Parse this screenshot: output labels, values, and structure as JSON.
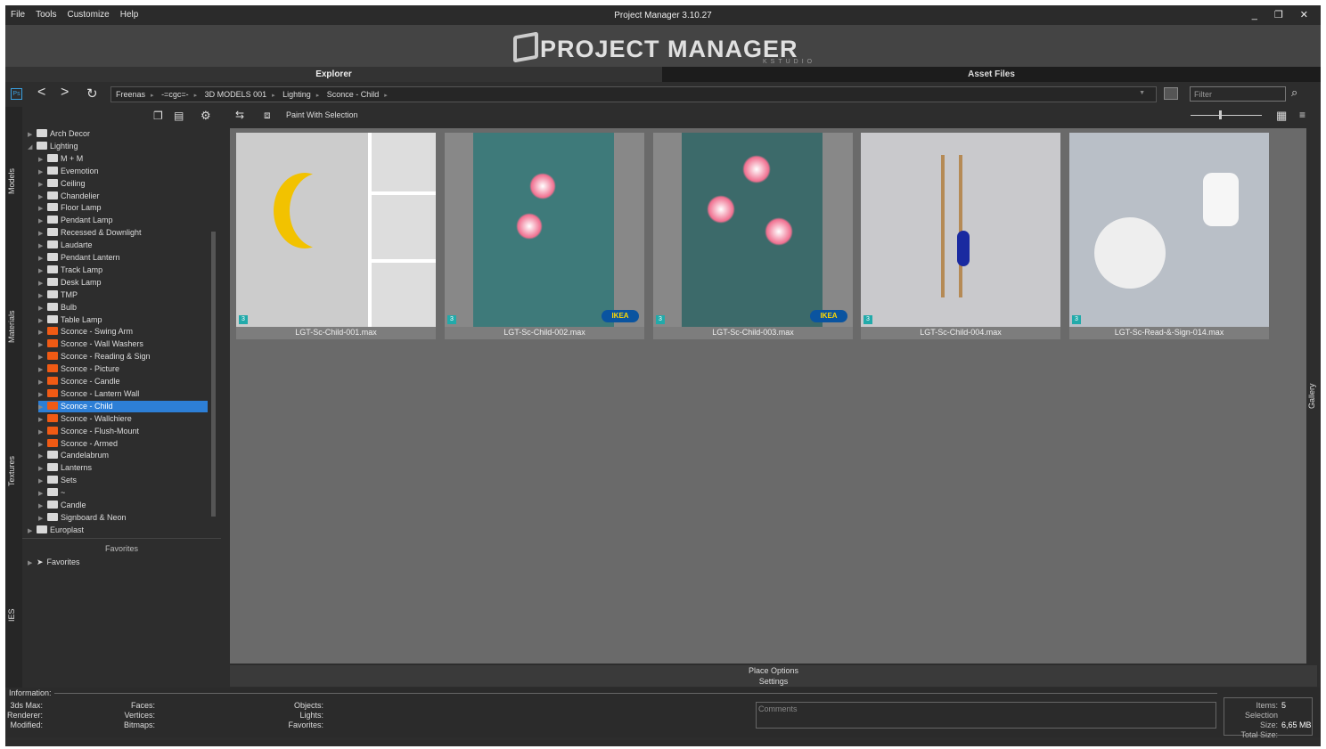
{
  "menu": [
    "File",
    "Tools",
    "Customize",
    "Help"
  ],
  "window_title": "Project Manager 3.10.27",
  "logo": {
    "title": "PROJECT MANAGER",
    "subtitle": "KSTUDIO"
  },
  "tabs": {
    "explorer": "Explorer",
    "asset_files": "Asset Files"
  },
  "breadcrumb": [
    "Freenas",
    "-=cgc=-",
    "3D MODELS 001",
    "Lighting",
    "Sconce - Child"
  ],
  "filter_placeholder": "Filter",
  "toolbar": {
    "paint": "Paint With Selection"
  },
  "vertical_tabs": [
    "Models",
    "Materials",
    "Textures",
    "IES"
  ],
  "tree": [
    {
      "label": "Arch Decor",
      "level": 0,
      "color": "#d8d8d8"
    },
    {
      "label": "Lighting",
      "level": 0,
      "color": "#d8d8d8",
      "open": true
    },
    {
      "label": "M + M",
      "level": 1,
      "color": "#d8d8d8"
    },
    {
      "label": "Evemotion",
      "level": 1,
      "color": "#d8d8d8"
    },
    {
      "label": "Ceiling",
      "level": 1,
      "color": "#d8d8d8"
    },
    {
      "label": "Chandelier",
      "level": 1,
      "color": "#d8d8d8"
    },
    {
      "label": "Floor Lamp",
      "level": 1,
      "color": "#d8d8d8"
    },
    {
      "label": "Pendant Lamp",
      "level": 1,
      "color": "#d8d8d8"
    },
    {
      "label": "Recessed & Downlight",
      "level": 1,
      "color": "#d8d8d8"
    },
    {
      "label": "Laudarte",
      "level": 1,
      "color": "#d8d8d8"
    },
    {
      "label": "Pendant Lantern",
      "level": 1,
      "color": "#d8d8d8"
    },
    {
      "label": "Track Lamp",
      "level": 1,
      "color": "#d8d8d8"
    },
    {
      "label": "Desk Lamp",
      "level": 1,
      "color": "#d8d8d8"
    },
    {
      "label": "TMP",
      "level": 1,
      "color": "#d8d8d8"
    },
    {
      "label": "Bulb",
      "level": 1,
      "color": "#d8d8d8"
    },
    {
      "label": "Table Lamp",
      "level": 1,
      "color": "#d8d8d8"
    },
    {
      "label": "Sconce - Swing Arm",
      "level": 1,
      "color": "#f05a14"
    },
    {
      "label": "Sconce - Wall Washers",
      "level": 1,
      "color": "#f05a14"
    },
    {
      "label": "Sconce - Reading & Sign",
      "level": 1,
      "color": "#f05a14"
    },
    {
      "label": "Sconce - Picture",
      "level": 1,
      "color": "#f05a14"
    },
    {
      "label": "Sconce - Candle",
      "level": 1,
      "color": "#f05a14"
    },
    {
      "label": "Sconce - Lantern Wall",
      "level": 1,
      "color": "#f05a14"
    },
    {
      "label": "Sconce - Child",
      "level": 1,
      "color": "#f05a14",
      "selected": true
    },
    {
      "label": "Sconce - Wallchiere",
      "level": 1,
      "color": "#f05a14"
    },
    {
      "label": "Sconce - Flush-Mount",
      "level": 1,
      "color": "#f05a14"
    },
    {
      "label": "Sconce - Armed",
      "level": 1,
      "color": "#f05a14"
    },
    {
      "label": "Candelabrum",
      "level": 1,
      "color": "#d8d8d8"
    },
    {
      "label": "Lanterns",
      "level": 1,
      "color": "#d8d8d8"
    },
    {
      "label": "Sets",
      "level": 1,
      "color": "#d8d8d8"
    },
    {
      "label": "~",
      "level": 1,
      "color": "#d8d8d8"
    },
    {
      "label": "Candle",
      "level": 1,
      "color": "#d8d8d8"
    },
    {
      "label": "Signboard & Neon",
      "level": 1,
      "color": "#d8d8d8"
    },
    {
      "label": "Europlast",
      "level": 0,
      "color": "#d8d8d8"
    }
  ],
  "favorites": {
    "header": "Favorites",
    "item": "Favorites"
  },
  "gallery": [
    {
      "name": "LGT-Sc-Child-001.max",
      "badge": "3"
    },
    {
      "name": "LGT-Sc-Child-002.max",
      "badge": "3",
      "ikea": "IKEA"
    },
    {
      "name": "LGT-Sc-Child-003.max",
      "badge": "3",
      "ikea": "IKEA"
    },
    {
      "name": "LGT-Sc-Child-004.max",
      "badge": "3"
    },
    {
      "name": "LGT-Sc-Read-&-Sign-014.max",
      "badge": "3"
    }
  ],
  "gallery_side_label": "Gallery",
  "place_options": "Place Options",
  "settings": "Settings",
  "info": {
    "header": "Information:",
    "col1": [
      "3ds Max:",
      "Renderer:",
      "Modified:"
    ],
    "col2": [
      "Faces:",
      "Vertices:",
      "Bitmaps:"
    ],
    "col3": [
      "Objects:",
      "Lights:",
      "Favorites:"
    ],
    "comments_placeholder": "Comments",
    "stats": {
      "items_label": "Items:",
      "items": "5",
      "selection_label": "Selection Size:",
      "total_label": "Total Size:",
      "total": "6,65 MB"
    }
  }
}
